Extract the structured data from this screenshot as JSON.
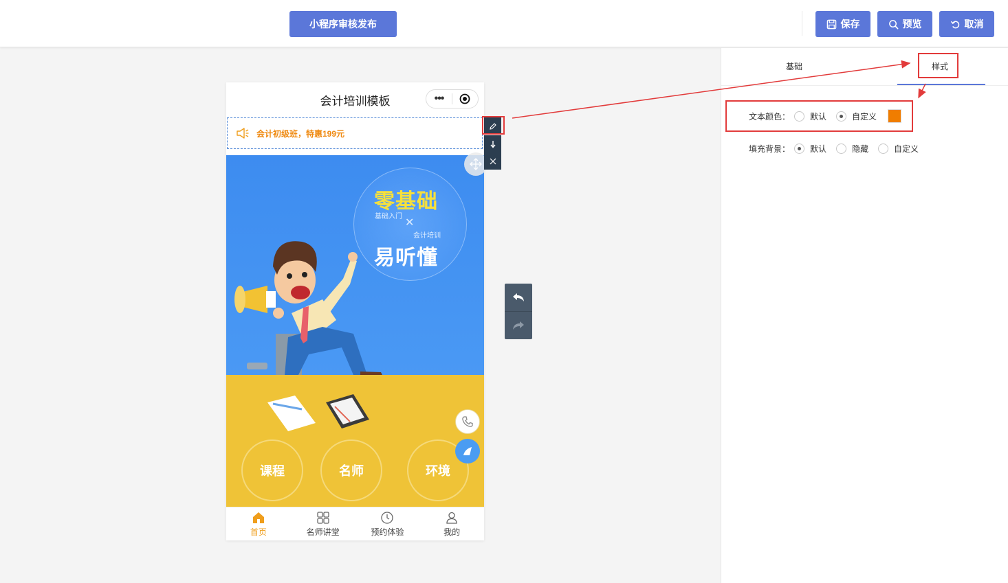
{
  "topbar": {
    "publish_label": "小程序审核发布",
    "save_label": "保存",
    "preview_label": "预览",
    "cancel_label": "取消"
  },
  "phone": {
    "title": "会计培训模板",
    "capsule_menu": "•••",
    "notice_text": "会计初级班，特惠199元",
    "banner": {
      "headline_1": "零基础",
      "sub_1": "基础入门",
      "cross": "✕",
      "sub_2": "会计培训",
      "headline_2": "易听懂"
    },
    "rings": [
      "课程",
      "名师",
      "环境"
    ],
    "tabbar": [
      {
        "label": "首页",
        "icon": "home-icon",
        "active": true
      },
      {
        "label": "名师讲堂",
        "icon": "grid-icon",
        "active": false
      },
      {
        "label": "预约体验",
        "icon": "clock-icon",
        "active": false
      },
      {
        "label": "我的",
        "icon": "user-icon",
        "active": false
      }
    ]
  },
  "panel": {
    "tabs": [
      "基础",
      "样式"
    ],
    "active_tab": "样式",
    "text_color": {
      "label": "文本颜色：",
      "options": [
        "默认",
        "自定义"
      ],
      "selected": "自定义",
      "color": "#f07d00"
    },
    "fill_bg": {
      "label": "填充背景：",
      "options": [
        "默认",
        "隐藏",
        "自定义"
      ],
      "selected": "默认"
    }
  },
  "colors": {
    "accent": "#5b77d9",
    "highlight": "#e23b3b",
    "notice_text": "#ef8a12",
    "tab_active": "#ef9e1c"
  }
}
